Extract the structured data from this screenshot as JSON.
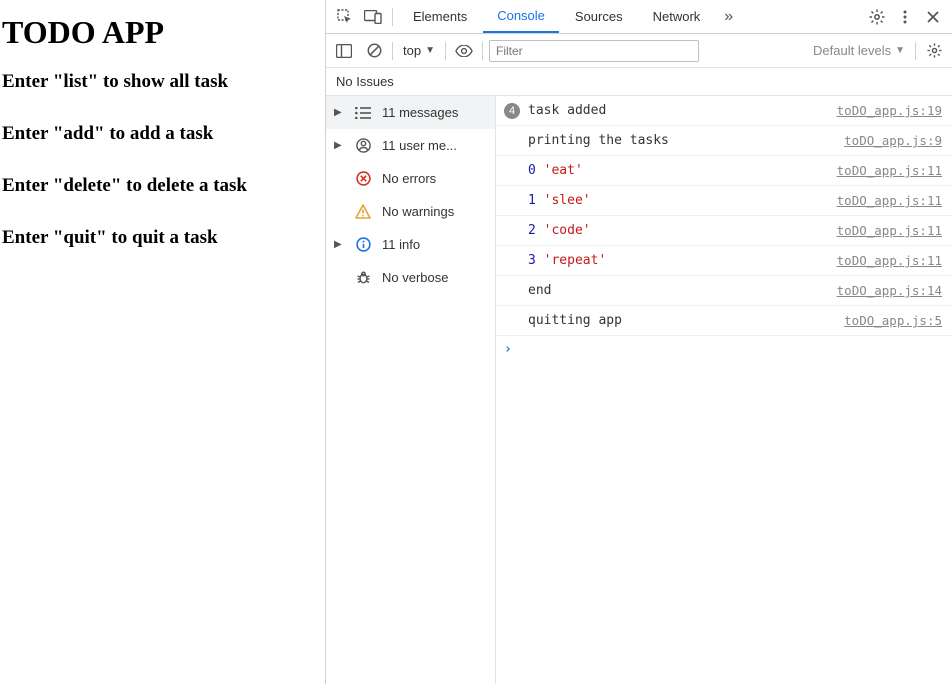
{
  "page": {
    "title": "TODO APP",
    "lines": [
      "Enter \"list\" to show all task",
      "Enter \"add\" to add a task",
      "Enter \"delete\" to delete a task",
      "Enter \"quit\" to quit a task"
    ]
  },
  "devtools": {
    "tabs": {
      "elements": "Elements",
      "console": "Console",
      "sources": "Sources",
      "network": "Network"
    },
    "more_glyph": "»",
    "toolbar": {
      "context": "top",
      "filter_placeholder": "Filter",
      "levels_label": "Default levels"
    },
    "issues": "No Issues",
    "sidebar": {
      "messages": "11 messages",
      "user": "11 user me...",
      "errors": "No errors",
      "warnings": "No warnings",
      "info": "11 info",
      "verbose": "No verbose"
    },
    "logs": [
      {
        "badge": "4",
        "text": "task added",
        "source": "toDO_app.js:19"
      },
      {
        "badge": "",
        "text": "printing the tasks",
        "source": "toDO_app.js:9"
      },
      {
        "badge": "",
        "idx": "0",
        "str": "'eat'",
        "source": "toDO_app.js:11"
      },
      {
        "badge": "",
        "idx": "1",
        "str": "'slee'",
        "source": "toDO_app.js:11"
      },
      {
        "badge": "",
        "idx": "2",
        "str": "'code'",
        "source": "toDO_app.js:11"
      },
      {
        "badge": "",
        "idx": "3",
        "str": "'repeat'",
        "source": "toDO_app.js:11"
      },
      {
        "badge": "",
        "text": "end",
        "source": "toDO_app.js:14"
      },
      {
        "badge": "",
        "text": "quitting app",
        "source": "toDO_app.js:5"
      }
    ],
    "prompt_glyph": "›"
  }
}
